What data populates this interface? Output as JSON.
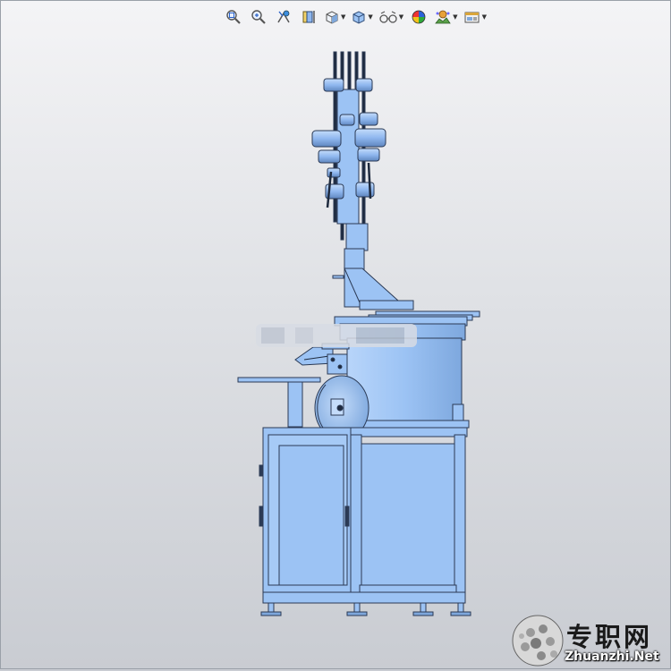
{
  "toolbar": {
    "buttons": [
      {
        "name": "zoom-to-fit-button",
        "icon": "zoom-to-fit-icon",
        "dropdown": false
      },
      {
        "name": "zoom-area-button",
        "icon": "zoom-area-icon",
        "dropdown": false
      },
      {
        "name": "previous-view-button",
        "icon": "previous-view-icon",
        "dropdown": false
      },
      {
        "name": "section-view-button",
        "icon": "section-view-icon",
        "dropdown": false
      },
      {
        "name": "view-orientation-button",
        "icon": "view-orientation-icon",
        "dropdown": true
      },
      {
        "name": "display-style-button",
        "icon": "display-style-icon",
        "dropdown": true
      },
      {
        "name": "hide-show-items-button",
        "icon": "hide-show-icon",
        "dropdown": true
      },
      {
        "name": "edit-appearance-button",
        "icon": "appearance-icon",
        "dropdown": false
      },
      {
        "name": "apply-scene-button",
        "icon": "scene-icon",
        "dropdown": true
      },
      {
        "name": "view-settings-button",
        "icon": "view-settings-icon",
        "dropdown": true
      }
    ]
  },
  "colors": {
    "part_fill": "#9cc3f4",
    "part_edge": "#2b3a55",
    "part_shade": "#7fa8dc",
    "part_light": "#c4dcfa"
  },
  "watermark": {
    "cn_text": "专职网",
    "en_text": "Zhuanzhi.Net"
  }
}
